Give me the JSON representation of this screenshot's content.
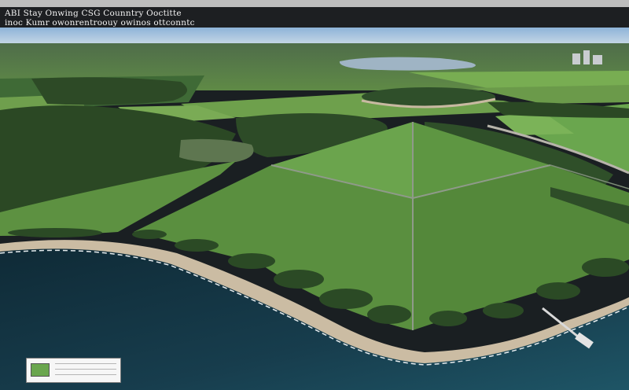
{
  "title": {
    "line1": "ABI Stay Onwing CSG Counntry Ooctitte",
    "line2": "inoc Kumr owonrentroouy owinos ottconntc"
  },
  "legend": {
    "swatch_color": "#6aa64e"
  },
  "colors": {
    "sky": "#a9c4de",
    "water": "#12303f",
    "field": "#5d9141",
    "field_dark": "#4a7c35",
    "forest": "#2d4a26",
    "beach": "#cbbca3"
  }
}
